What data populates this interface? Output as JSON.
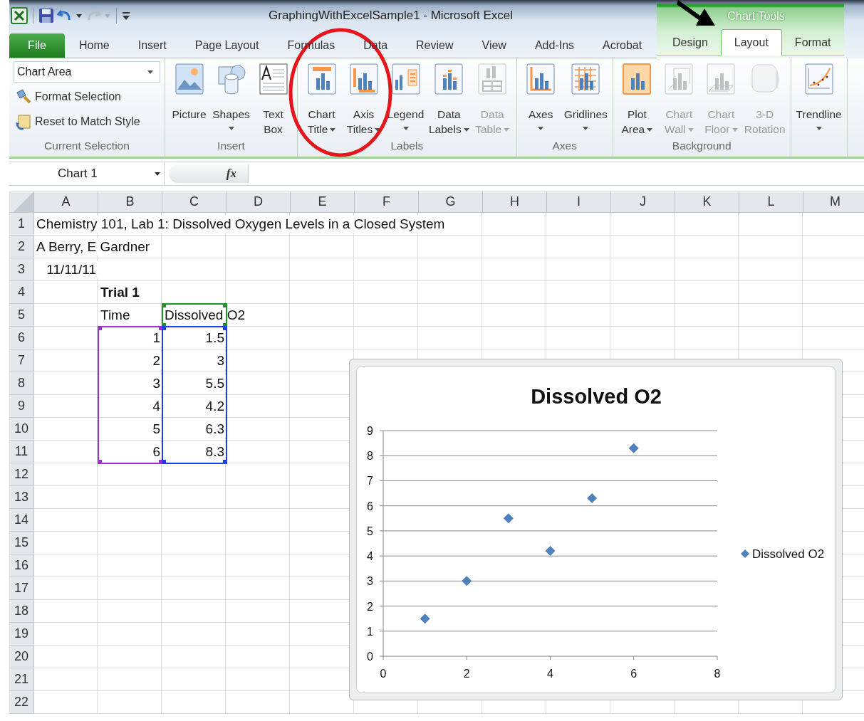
{
  "window": {
    "title": "GraphingWithExcelSample1  -  Microsoft Excel",
    "context_label": "Chart Tools"
  },
  "tabs": [
    {
      "label": "File",
      "kind": "file",
      "selected": false
    },
    {
      "label": "Home",
      "kind": "standard",
      "selected": false
    },
    {
      "label": "Insert",
      "kind": "standard",
      "selected": false
    },
    {
      "label": "Page Layout",
      "kind": "standard",
      "selected": false
    },
    {
      "label": "Formulas",
      "kind": "standard",
      "selected": false
    },
    {
      "label": "Data",
      "kind": "standard",
      "selected": false
    },
    {
      "label": "Review",
      "kind": "standard",
      "selected": false
    },
    {
      "label": "View",
      "kind": "standard",
      "selected": false
    },
    {
      "label": "Add-Ins",
      "kind": "standard",
      "selected": false
    },
    {
      "label": "Acrobat",
      "kind": "standard",
      "selected": false
    },
    {
      "label": "Design",
      "kind": "contextual",
      "selected": false
    },
    {
      "label": "Layout",
      "kind": "contextual",
      "selected": true
    },
    {
      "label": "Format",
      "kind": "contextual",
      "selected": false
    }
  ],
  "ribbon": {
    "groups": [
      {
        "label": "Current Selection",
        "kind": "selection",
        "dropdown_value": "Chart Area",
        "commands": [
          {
            "label": "Format Selection",
            "kind": "brush"
          },
          {
            "label": "Reset to Match Style",
            "kind": "reset"
          }
        ]
      },
      {
        "label": "Insert",
        "kind": "buttons",
        "buttons": [
          {
            "lines": [
              "Picture"
            ],
            "kind": "picture",
            "dropdown": false,
            "disabled": false
          },
          {
            "lines": [
              "Shapes"
            ],
            "kind": "shapes",
            "dropdown": true,
            "disabled": false
          },
          {
            "lines": [
              "Text",
              "Box"
            ],
            "kind": "textbox",
            "dropdown": false,
            "disabled": false
          }
        ]
      },
      {
        "label": "Labels",
        "kind": "buttons",
        "buttons": [
          {
            "lines": [
              "Chart",
              "Title"
            ],
            "kind": "chart_title",
            "dropdown": true,
            "disabled": false
          },
          {
            "lines": [
              "Axis",
              "Titles"
            ],
            "kind": "axis_titles",
            "dropdown": true,
            "disabled": false
          },
          {
            "lines": [
              "Legend"
            ],
            "kind": "legend",
            "dropdown": true,
            "disabled": false
          },
          {
            "lines": [
              "Data",
              "Labels"
            ],
            "kind": "data_labels",
            "dropdown": true,
            "disabled": false
          },
          {
            "lines": [
              "Data",
              "Table"
            ],
            "kind": "data_table",
            "dropdown": true,
            "disabled": true
          }
        ]
      },
      {
        "label": "Axes",
        "kind": "buttons",
        "buttons": [
          {
            "lines": [
              "Axes"
            ],
            "kind": "axes",
            "dropdown": true,
            "disabled": false
          },
          {
            "lines": [
              "Gridlines"
            ],
            "kind": "gridlines",
            "dropdown": true,
            "disabled": false
          }
        ]
      },
      {
        "label": "Background",
        "kind": "buttons",
        "buttons": [
          {
            "lines": [
              "Plot",
              "Area"
            ],
            "kind": "plot_area",
            "dropdown": true,
            "disabled": false
          },
          {
            "lines": [
              "Chart",
              "Wall"
            ],
            "kind": "chart_wall",
            "dropdown": true,
            "disabled": true
          },
          {
            "lines": [
              "Chart",
              "Floor"
            ],
            "kind": "chart_floor",
            "dropdown": true,
            "disabled": true
          },
          {
            "lines": [
              "3-D",
              "Rotation"
            ],
            "kind": "rotation",
            "dropdown": false,
            "disabled": true
          }
        ]
      },
      {
        "kind": "buttons",
        "buttons": [
          {
            "lines": [
              "Trendline"
            ],
            "kind": "trendline",
            "dropdown": true,
            "disabled": false
          }
        ]
      }
    ]
  },
  "formula_bar": {
    "name_box": "Chart 1",
    "function_label": "fx"
  },
  "sheet": {
    "columns": [
      "A",
      "B",
      "C",
      "D",
      "E",
      "F",
      "G",
      "H",
      "I",
      "J",
      "K",
      "L",
      "M"
    ],
    "rows": [
      {
        "header": "1",
        "cells": [
          {
            "text": "Chemistry 101, Lab 1: Dissolved Oxygen Levels in a Closed System",
            "kind": "text"
          }
        ]
      },
      {
        "header": "2",
        "cells": [
          {
            "text": "A Berry, E Gardner",
            "kind": "text"
          }
        ]
      },
      {
        "header": "3",
        "cells": [
          {
            "text": "11/11/11",
            "kind": "number"
          }
        ]
      },
      {
        "header": "4",
        "cells": [
          null,
          {
            "text": "Trial 1",
            "kind": "text",
            "bold": true
          }
        ]
      },
      {
        "header": "5",
        "cells": [
          null,
          {
            "text": "Time",
            "kind": "text"
          },
          {
            "text": "Dissolved O2",
            "kind": "text",
            "color": "#22922a"
          }
        ]
      },
      {
        "header": "6",
        "cells": [
          null,
          {
            "text": "1",
            "kind": "number",
            "color": "#a030d0"
          },
          {
            "text": "1.5",
            "kind": "number",
            "color": "#1f3fe8"
          }
        ]
      },
      {
        "header": "7",
        "cells": [
          null,
          {
            "text": "2",
            "kind": "number",
            "color": "#a030d0"
          },
          {
            "text": "3",
            "kind": "number",
            "color": "#1f3fe8"
          }
        ]
      },
      {
        "header": "8",
        "cells": [
          null,
          {
            "text": "3",
            "kind": "number",
            "color": "#a030d0"
          },
          {
            "text": "5.5",
            "kind": "number",
            "color": "#1f3fe8"
          }
        ]
      },
      {
        "header": "9",
        "cells": [
          null,
          {
            "text": "4",
            "kind": "number",
            "color": "#a030d0"
          },
          {
            "text": "4.2",
            "kind": "number",
            "color": "#1f3fe8"
          }
        ]
      },
      {
        "header": "10",
        "cells": [
          null,
          {
            "text": "5",
            "kind": "number",
            "color": "#a030d0"
          },
          {
            "text": "6.3",
            "kind": "number",
            "color": "#1f3fe8"
          }
        ]
      },
      {
        "header": "11",
        "cells": [
          null,
          {
            "text": "6",
            "kind": "number",
            "color": "#a030d0"
          },
          {
            "text": "8.3",
            "kind": "number",
            "color": "#1f3fe8"
          }
        ]
      },
      {
        "header": "12"
      },
      {
        "header": "13"
      },
      {
        "header": "14"
      },
      {
        "header": "15"
      },
      {
        "header": "16"
      },
      {
        "header": "17"
      },
      {
        "header": "18"
      },
      {
        "header": "19"
      },
      {
        "header": "20"
      },
      {
        "header": "21"
      },
      {
        "header": "22"
      }
    ],
    "chart": {
      "chart_data": {
        "type": "scatter",
        "title": "Dissolved O2",
        "x": [
          1,
          2,
          3,
          4,
          5,
          6
        ],
        "series": [
          {
            "name": "Dissolved O2",
            "color": "#4f81bd",
            "values": [
              1.5,
              3,
              5.5,
              4.2,
              6.3,
              8.3
            ]
          }
        ],
        "grid": true,
        "xlim": [
          0,
          8
        ],
        "ylim": [
          0,
          9
        ],
        "xticks": [
          0,
          2,
          4,
          6,
          8
        ],
        "yticks": [
          0,
          1,
          2,
          3,
          4,
          5,
          6,
          7,
          8,
          9
        ]
      }
    }
  }
}
